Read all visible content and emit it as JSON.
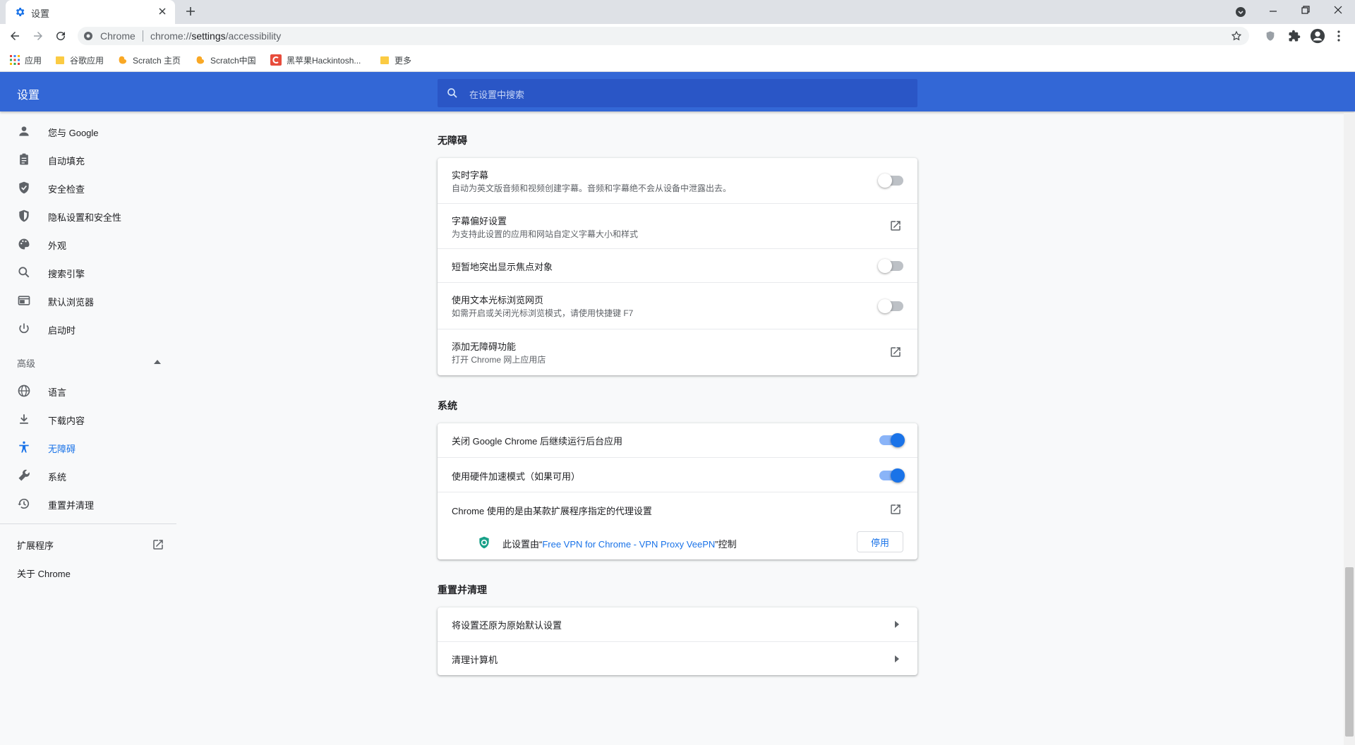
{
  "browser": {
    "tab_title": "设置",
    "omnibox": {
      "chip": "Chrome",
      "url_scheme": "chrome://",
      "url_host": "settings",
      "url_path": "/accessibility"
    },
    "bookmarks": [
      "应用",
      "谷歌应用",
      "Scratch 主页",
      "Scratch中国",
      "黑苹果Hackintosh...",
      "更多"
    ],
    "colors": {
      "accent": "#1a73e8",
      "header": "#3367d6"
    }
  },
  "header": {
    "title": "设置",
    "search_placeholder": "在设置中搜索"
  },
  "sidebar": {
    "items": [
      "您与 Google",
      "自动填充",
      "安全检查",
      "隐私设置和安全性",
      "外观",
      "搜索引擎",
      "默认浏览器",
      "启动时"
    ],
    "advanced_label": "高级",
    "advanced_items": [
      "语言",
      "下载内容",
      "无障碍",
      "系统",
      "重置并清理"
    ],
    "extensions": "扩展程序",
    "about": "关于 Chrome"
  },
  "accessibility": {
    "title": "无障碍",
    "rows": [
      {
        "title": "实时字幕",
        "sub": "自动为英文版音频和视频创建字幕。音频和字幕绝不会从设备中泄露出去。",
        "control": "toggle",
        "on": false
      },
      {
        "title": "字幕偏好设置",
        "sub": "为支持此设置的应用和网站自定义字幕大小和样式",
        "control": "external"
      },
      {
        "title": "短暂地突出显示焦点对象",
        "sub": "",
        "control": "toggle",
        "on": false
      },
      {
        "title": "使用文本光标浏览网页",
        "sub": "如需开启或关闭光标浏览模式，请使用快捷键 F7",
        "control": "toggle",
        "on": false
      },
      {
        "title": "添加无障碍功能",
        "sub": "打开 Chrome 网上应用店",
        "control": "external"
      }
    ]
  },
  "system": {
    "title": "系统",
    "rows": [
      {
        "title": "关闭 Google Chrome 后继续运行后台应用",
        "control": "toggle",
        "on": true
      },
      {
        "title": "使用硬件加速模式（如果可用）",
        "control": "toggle",
        "on": true
      },
      {
        "title": "Chrome 使用的是由某款扩展程序指定的代理设置",
        "control": "external"
      }
    ],
    "controlled_prefix": "此设置由“",
    "controlled_ext": "Free VPN for Chrome - VPN Proxy VeePN",
    "controlled_suffix": "”控制",
    "disable_button": "停用"
  },
  "reset": {
    "title": "重置并清理",
    "rows": [
      "将设置还原为原始默认设置",
      "清理计算机"
    ]
  }
}
